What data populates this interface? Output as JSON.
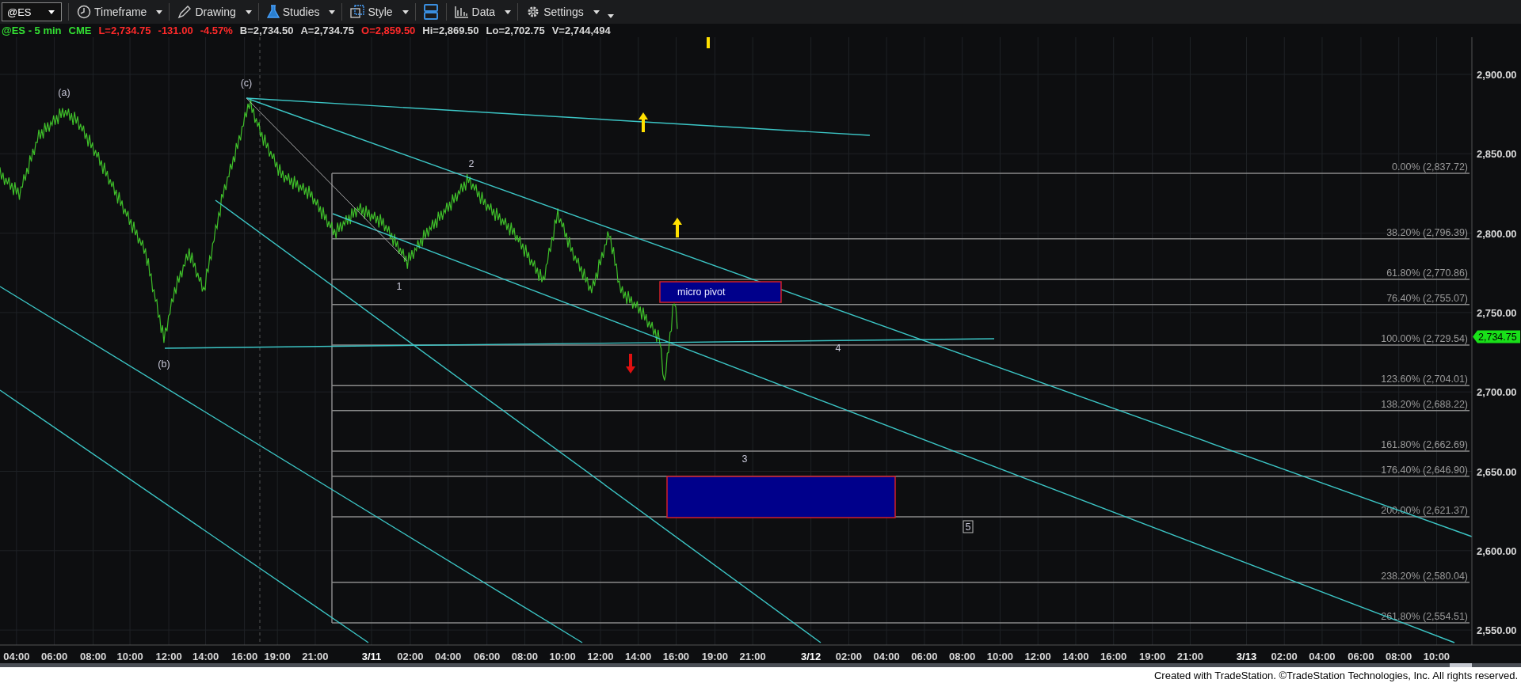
{
  "toolbar": {
    "symbol": "@ES",
    "buttons": [
      {
        "kind": "clock",
        "label": "Timeframe"
      },
      {
        "kind": "pencil",
        "label": "Drawing"
      },
      {
        "kind": "flask",
        "label": "Studies"
      },
      {
        "kind": "style",
        "label": "Style"
      },
      {
        "kind": "layout"
      },
      {
        "kind": "bars",
        "label": "Data"
      },
      {
        "kind": "gear",
        "label": "Settings"
      }
    ]
  },
  "quote_line": [
    {
      "text": "@ES - 5 min",
      "color": "#33e033"
    },
    {
      "text": "CME",
      "color": "#33e033"
    },
    {
      "text": "L=2,734.75",
      "color": "#ff2a2a"
    },
    {
      "text": "-131.00",
      "color": "#ff2a2a"
    },
    {
      "text": "-4.57%",
      "color": "#ff2a2a"
    },
    {
      "text": "B=2,734.50",
      "color": "#d8d8d8"
    },
    {
      "text": "A=2,734.75",
      "color": "#d8d8d8"
    },
    {
      "text": "O=2,859.50",
      "color": "#ff2a2a"
    },
    {
      "text": "Hi=2,869.50",
      "color": "#d8d8d8"
    },
    {
      "text": "Lo=2,702.75",
      "color": "#d8d8d8"
    },
    {
      "text": "V=2,744,494",
      "color": "#d8d8d8"
    }
  ],
  "chart": {
    "price_axis": [
      "2,900.00",
      "2,850.00",
      "2,800.00",
      "2,750.00",
      "2,700.00",
      "2,650.00",
      "2,600.00",
      "2,550.00"
    ],
    "last_price": "2,734.75",
    "fib_levels": [
      "0.00% (2,837.72)",
      "38.20% (2,796.39)",
      "61.80% (2,770.86)",
      "76.40% (2,755.07)",
      "100.00% (2,729.54)",
      "123.60% (2,704.01)",
      "138.20% (2,688.22)",
      "161.80% (2,662.69)",
      "176.40% (2,646.90)",
      "200.00% (2,621.37)",
      "238.20% (2,580.04)",
      "261.80% (2,554.51)"
    ],
    "wave_labels": [
      {
        "text": "(a)",
        "kind": "plain"
      },
      {
        "text": "(c)",
        "kind": "plain"
      },
      {
        "text": "(b)",
        "kind": "plain"
      },
      {
        "text": "2",
        "kind": "plain"
      },
      {
        "text": "1",
        "kind": "plain"
      },
      {
        "text": "4",
        "kind": "plain"
      },
      {
        "text": "3",
        "kind": "plain"
      },
      {
        "text": "5",
        "kind": "boxed"
      }
    ],
    "pivot_box": {
      "label": "micro pivot"
    },
    "time_axis": [
      {
        "text": "04:00",
        "kind": "time"
      },
      {
        "text": "06:00",
        "kind": "time"
      },
      {
        "text": "08:00",
        "kind": "time"
      },
      {
        "text": "10:00",
        "kind": "time"
      },
      {
        "text": "12:00",
        "kind": "time"
      },
      {
        "text": "14:00",
        "kind": "time"
      },
      {
        "text": "16:00",
        "kind": "time"
      },
      {
        "text": "19:00",
        "kind": "time"
      },
      {
        "text": "21:00",
        "kind": "time"
      },
      {
        "text": "3/11",
        "kind": "date"
      },
      {
        "text": "02:00",
        "kind": "time"
      },
      {
        "text": "04:00",
        "kind": "time"
      },
      {
        "text": "06:00",
        "kind": "time"
      },
      {
        "text": "08:00",
        "kind": "time"
      },
      {
        "text": "10:00",
        "kind": "time"
      },
      {
        "text": "12:00",
        "kind": "time"
      },
      {
        "text": "14:00",
        "kind": "time"
      },
      {
        "text": "16:00",
        "kind": "time"
      },
      {
        "text": "19:00",
        "kind": "time"
      },
      {
        "text": "21:00",
        "kind": "time"
      },
      {
        "text": "3/12",
        "kind": "date"
      },
      {
        "text": "02:00",
        "kind": "time"
      },
      {
        "text": "04:00",
        "kind": "time"
      },
      {
        "text": "06:00",
        "kind": "time"
      },
      {
        "text": "08:00",
        "kind": "time"
      },
      {
        "text": "10:00",
        "kind": "time"
      },
      {
        "text": "12:00",
        "kind": "time"
      },
      {
        "text": "14:00",
        "kind": "time"
      },
      {
        "text": "16:00",
        "kind": "time"
      },
      {
        "text": "19:00",
        "kind": "time"
      },
      {
        "text": "21:00",
        "kind": "time"
      },
      {
        "text": "3/13",
        "kind": "date"
      },
      {
        "text": "02:00",
        "kind": "time"
      },
      {
        "text": "04:00",
        "kind": "time"
      },
      {
        "text": "06:00",
        "kind": "time"
      },
      {
        "text": "08:00",
        "kind": "time"
      },
      {
        "text": "10:00",
        "kind": "time"
      }
    ]
  },
  "footer": "Created with TradeStation. ©TradeStation Technologies, Inc. All rights reserved."
}
